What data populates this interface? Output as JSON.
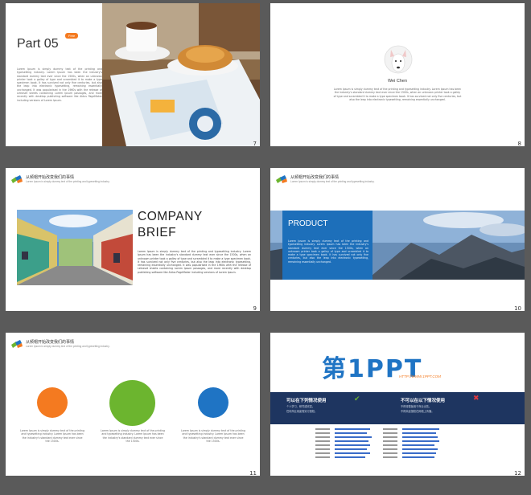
{
  "header_common": {
    "title": "从频帽开始改变我们的事情",
    "subtitle": "Lorem Ipsum is simply dummy text of the printing and typesetting industry."
  },
  "slides": [
    {
      "number": "7",
      "title": "Part 05",
      "badge": "Free",
      "body": "Lorem Ipsum is simply dummy text of the printing and typesetting industry. Lorem Ipsum has been the industry's standard dummy text ever since the 1500s, when an unknown printer took a galley of type and scrambled it to make a type specimen book. It has survived not only five centuries, but also the leap into electronic typesetting, remaining essentially unchanged. It was popularised in the 1960s with the release of Letraset sheets containing Lorem Ipsum passages, and more recently with desktop publishing software like Aldus PageMaker including versions of Lorem Ipsum."
    },
    {
      "number": "8",
      "name": "Wei Chen",
      "body": "Lorem Ipsum is simply dummy text of the printing and typesetting industry. Lorem Ipsum has been the industry's standard dummy text ever since the 1500s, when an unknown printer took a galley of type and scrambled it to make a type specimen book. It has survived not only five centuries, but also the leap into electronic typesetting, remaining essentially unchanged."
    },
    {
      "number": "9",
      "title_line1": "COMPANY",
      "title_line2": "BRIEF",
      "body": "Lorem Ipsum is simply dummy text of the printing and typesetting industry. Lorem Ipsum has been the industry's standard dummy text ever since the 1500s, when an unknown printer took a galley of type and scrambled it to make a type specimen book. It has survived not only five centuries, but also the leap into electronic typesetting, remaining essentially unchanged. It was popularised in the 1960s with the release of Letraset sheets containing Lorem Ipsum passages, and more recently with desktop publishing software like Aldus PageMaker including versions of Lorem Ipsum."
    },
    {
      "number": "10",
      "title": "PRODUCT",
      "body": "Lorem Ipsum is simply dummy text of the printing and typesetting industry. Lorem Ipsum has been the industry's standard dummy text ever since the 1500s, when an unknown printer took a galley of type and scrambled it to make a type specimen book. It has survived not only five centuries, but also the leap into electronic typesetting, remaining essentially unchanged."
    },
    {
      "number": "11",
      "circles": [
        {
          "color": "#f47a20",
          "text": "Lorem Ipsum is simply dummy text of the printing and typesetting industry. Lorem Ipsum has been the industry's standard dummy text ever since the 1500s."
        },
        {
          "color": "#6cb52f",
          "text": "Lorem Ipsum is simply dummy text of the printing and typesetting industry. Lorem Ipsum has been the industry's standard dummy text ever since the 1500s."
        },
        {
          "color": "#1f74c4",
          "text": "Lorem Ipsum is simply dummy text of the printing and typesetting industry. Lorem Ipsum has been the industry's standard dummy text ever since the 1500s."
        }
      ]
    },
    {
      "number": "12",
      "logo_main": "第1PPT",
      "logo_url": "HTTP://WWW.1PPT.COM",
      "can_title": "可以在下列情况使用",
      "cannot_title": "不可以在以下情况使用",
      "can_items": [
        "个人学习、研究或欣赏。",
        "任何商业用途需另行授权。"
      ],
      "cannot_items": [
        "不得将模板用于商业出售。",
        "不得未经授权在网络上传播。"
      ]
    }
  ],
  "colors": {
    "orange": "#f47a20",
    "green": "#6cb52f",
    "blue": "#1f74c4",
    "navy": "#1e3560",
    "product_blue": "#1d6fba"
  }
}
